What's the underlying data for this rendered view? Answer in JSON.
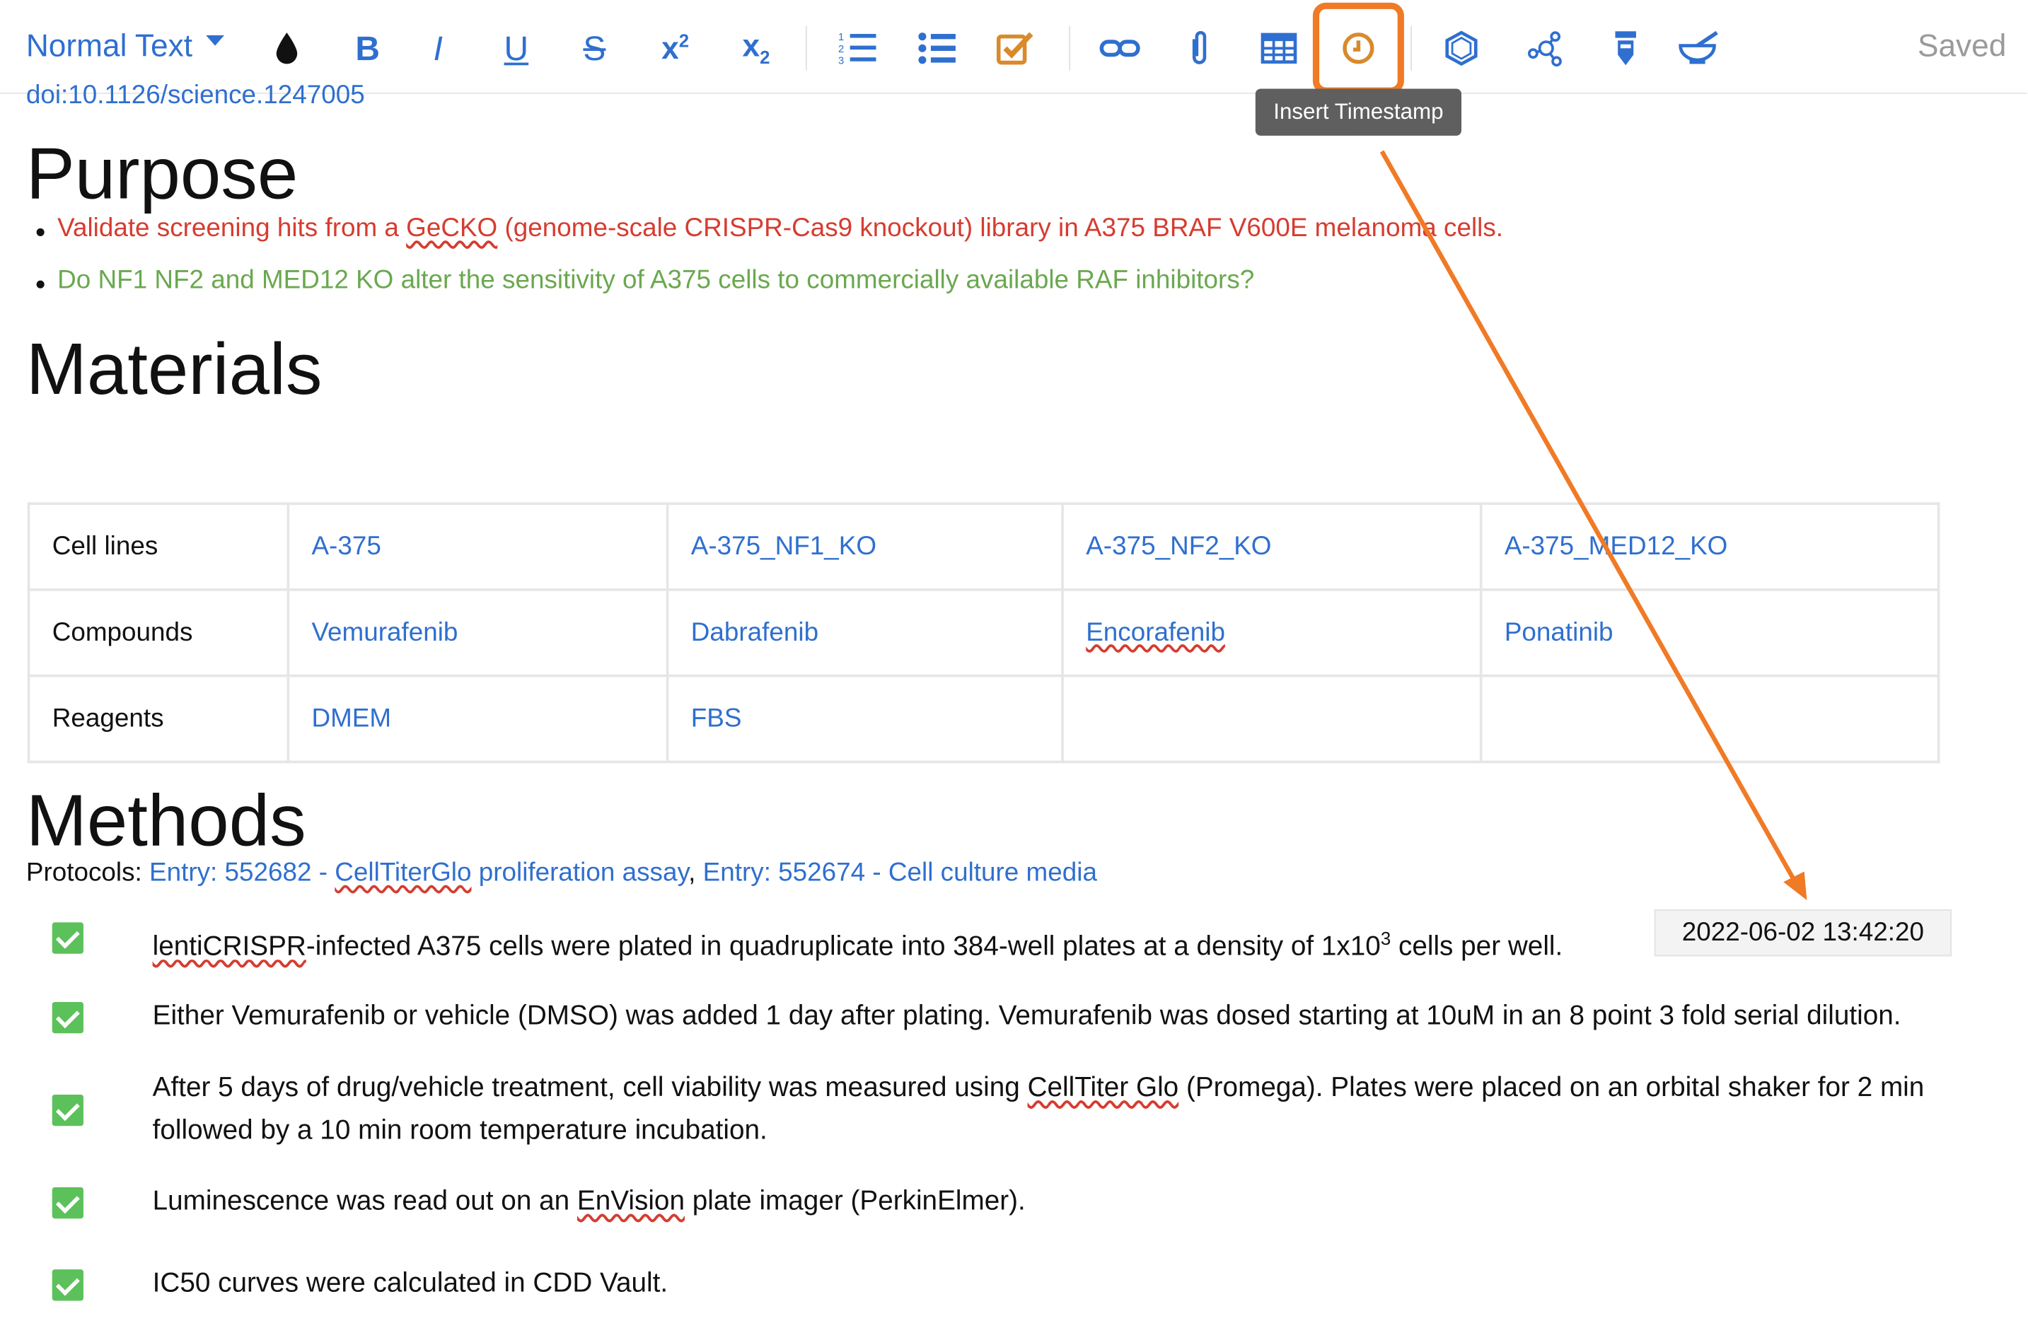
{
  "toolbar": {
    "style_select": "Normal Text",
    "saved": "Saved",
    "tooltip": "Insert Timestamp",
    "accent": "#2f6fcf",
    "highlight_color": "#f07a25",
    "icons": [
      "ink-drop-icon",
      "bold-icon",
      "italic-icon",
      "underline-icon",
      "strikethrough-icon",
      "superscript-icon",
      "subscript-icon",
      "ordered-list-icon",
      "bullet-list-icon",
      "checkbox-icon",
      "link-icon",
      "attachment-icon",
      "table-icon",
      "clock-icon",
      "hexagon-icon",
      "molecule-icon",
      "test-tube-icon",
      "mortar-icon"
    ],
    "bold": "B",
    "italic": "I",
    "underline": "U",
    "strike": "S",
    "sup_x": "x",
    "sup_2": "2",
    "sub_x": "x",
    "sub_2": "2"
  },
  "doc": {
    "doi": "doi:10.1126/science.1247005",
    "purpose": {
      "heading": "Purpose",
      "bullets": [
        {
          "pre": "Validate screening hits from a ",
          "mark": "GeCKO",
          "post": " (genome-scale CRISPR-Cas9 knockout) library in A375 BRAF V600E melanoma cells."
        },
        {
          "text": "Do NF1 NF2 and MED12 KO alter the sensitivity of A375 cells to commercially available RAF inhibitors?"
        }
      ]
    },
    "materials": {
      "heading": "Materials",
      "rows": [
        {
          "head": "Cell lines",
          "cells": [
            "A-375",
            "A-375_NF1_KO",
            "A-375_NF2_KO",
            "A-375_MED12_KO"
          ]
        },
        {
          "head": "Compounds",
          "cells": [
            "Vemurafenib",
            "Dabrafenib",
            "Encorafenib",
            "Ponatinib"
          ]
        },
        {
          "head": "Reagents",
          "cells": [
            "DMEM",
            "FBS",
            "",
            ""
          ]
        }
      ]
    },
    "methods": {
      "heading": "Methods",
      "protocols_label": "Protocols: ",
      "protocol_1a": "Entry: 552682 - ",
      "protocol_1b": "CellTiterGlo",
      "protocol_1c": " proliferation assay",
      "protocol_sep": ", ",
      "protocol_2": "Entry: 552674 - Cell culture media",
      "steps": [
        {
          "a": "lentiCRISPR",
          "b": "-infected A375 cells were plated in quadruplicate into 384-well plates at a density of 1x10",
          "sup": "3",
          "c": " cells per well."
        },
        {
          "text": "Either Vemurafenib or vehicle (DMSO) was added 1 day after plating. Vemurafenib was dosed starting at 10uM in an 8 point 3 fold serial dilution."
        },
        {
          "a": "After 5 days of drug/vehicle treatment, cell viability was measured using ",
          "b": "CellTiter Glo",
          "c": " (Promega). Plates were placed on an orbital shaker for 2 min followed by a 10 min room temperature incubation."
        },
        {
          "a": "Luminescence was read out on an ",
          "b": "EnVision",
          "c": " plate imager (PerkinElmer)."
        },
        {
          "text": "IC50 curves were calculated in CDD Vault."
        }
      ],
      "timestamp": "2022-06-02 13:42:20"
    }
  }
}
